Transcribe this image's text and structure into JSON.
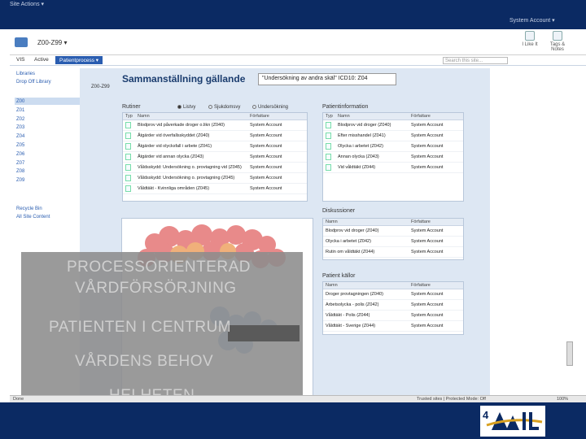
{
  "topbar": {
    "suite_left": "Site Actions ▾",
    "user_menu": "System Account ▾"
  },
  "ribbon": {
    "site_title": "Z00-Z99  ▾",
    "buttons": [
      {
        "label": "I Like It",
        "icon": "thumbs-up-icon"
      },
      {
        "label": "Tags & Notes",
        "icon": "tag-icon"
      }
    ]
  },
  "nav": {
    "tabs": [
      "VIS",
      "Active"
    ],
    "active_tab": "Patientprocess ▾",
    "search_placeholder": "Search this site..."
  },
  "quick_launch": {
    "libraries_heading": "Libraries",
    "library_item": "Drop Off Library",
    "codes": [
      "Z00",
      "Z01",
      "Z02",
      "Z03",
      "Z04",
      "Z05",
      "Z06",
      "Z07",
      "Z08",
      "Z09"
    ],
    "selected": "Z00",
    "bottom": [
      "Recycle Bin",
      "All Site Content"
    ]
  },
  "header": {
    "title": "Sammanställning gällande",
    "box": "\"Undersökning av andra skäl\" ICD10: Z04",
    "subcode": "Z00-Z99"
  },
  "rutiner": {
    "title": "Rutiner",
    "radios": [
      "Listvy",
      "Sjukdomsvy",
      "Undersökning"
    ],
    "columns": [
      "Typ",
      "Namn",
      "Författare"
    ],
    "rows": [
      {
        "name": "Blodprov vid påverkade droger o.likn (Z040)",
        "author": "System Account"
      },
      {
        "name": "Åtgärder vid överfallsskyddet (Z040)",
        "author": "System Account"
      },
      {
        "name": "Åtgärder vid olycksfall i arbete (Z041)",
        "author": "System Account"
      },
      {
        "name": "Åtgärder vid annan olycka (Z043)",
        "author": "System Account"
      },
      {
        "name": "Våldsskydd: Undersökning o. provtagning vid (Z045)",
        "author": "System Account"
      },
      {
        "name": "Våldsskydd: Undersökning o. provtagning (Z045)",
        "author": "System Account"
      },
      {
        "name": "Våldtäkt - Kvinnliga områden (Z045)",
        "author": "System Account"
      }
    ]
  },
  "patientinfo": {
    "title": "Patientinformation",
    "columns": [
      "Typ",
      "Namn",
      "Författare"
    ],
    "rows": [
      {
        "name": "Blodprov vid droger (Z040)",
        "author": "System Account"
      },
      {
        "name": "Efter misshandel (Z041)",
        "author": "System Account"
      },
      {
        "name": "Olycka i arbetet (Z042)",
        "author": "System Account"
      },
      {
        "name": "Annan olycka (Z043)",
        "author": "System Account"
      },
      {
        "name": "Vid våldtäkt (Z044)",
        "author": "System Account"
      }
    ]
  },
  "diskussioner": {
    "title": "Diskussioner",
    "columns": [
      "Namn",
      "Författare"
    ],
    "rows": [
      {
        "name": "Blodprov vid droger (Z040)",
        "author": "System Account"
      },
      {
        "name": "Olycka i arbetet (Z042)",
        "author": "System Account"
      },
      {
        "name": "Rutin om våldtäkt (Z044)",
        "author": "System Account"
      }
    ]
  },
  "patientkallor": {
    "title": "Patient källor",
    "columns": [
      "Namn",
      "Författare"
    ],
    "rows": [
      {
        "name": "Droger provtagningen (Z040)",
        "author": "System Account"
      },
      {
        "name": "Arbetsolycka - polis (Z042)",
        "author": "System Account"
      },
      {
        "name": "Våldtäkt - Polis (Z044)",
        "author": "System Account"
      },
      {
        "name": "Våldtäkt - Sverige (Z044)",
        "author": "System Account"
      }
    ]
  },
  "overlay": {
    "lines": [
      "PROCESSORIENTERAD",
      "VÅRDFÖRSÖRJNING",
      "PATIENTEN I CENTRUM",
      "VÅRDENS BEHOV",
      "HELHETEN"
    ]
  },
  "status": {
    "left": "Done",
    "right": "Trusted sites | Protected Mode: Off",
    "zoom": "100%"
  },
  "slide": {
    "number": "4"
  },
  "colors": {
    "frame": "#0b2a63",
    "panel_bg": "#dde7f3",
    "accent": "#2a5db0",
    "overlay": "#8c8c8c"
  }
}
